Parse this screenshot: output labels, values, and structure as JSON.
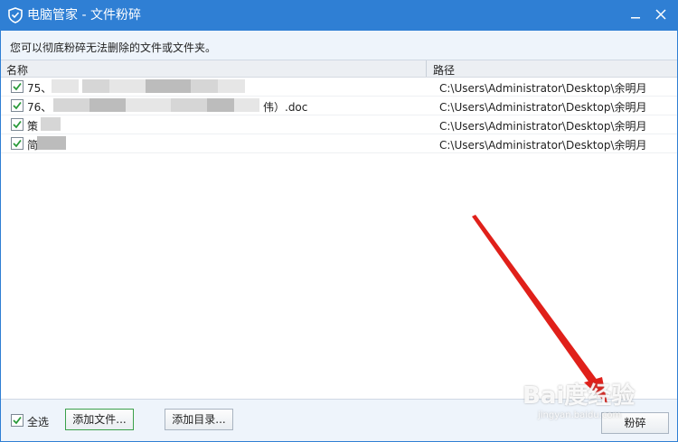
{
  "window": {
    "title": "电脑管家 - 文件粉碎"
  },
  "description": "您可以彻底粉碎无法删除的文件或文件夹。",
  "list": {
    "col_name": "名称",
    "col_path": "路径",
    "rows": [
      {
        "name": "75、",
        "path": "C:\\Users\\Administrator\\Desktop\\余明月",
        "checked": true
      },
      {
        "name": "76、",
        "name_suffix": "伟）.doc",
        "path": "C:\\Users\\Administrator\\Desktop\\余明月",
        "checked": true
      },
      {
        "name": "策",
        "path": "C:\\Users\\Administrator\\Desktop\\余明月",
        "checked": true
      },
      {
        "name": "简",
        "path": "C:\\Users\\Administrator\\Desktop\\余明月",
        "checked": true
      }
    ]
  },
  "bottom": {
    "select_all": "全选",
    "add_file": "添加文件...",
    "add_dir": "添加目录...",
    "shred": "粉碎"
  },
  "watermark": {
    "text": "Bai度经验",
    "sub": "jingyan.baidu.com"
  },
  "colors": {
    "titlebar": "#2f7fd4",
    "accent_arrow": "#e0201a",
    "check": "#2a9a3a"
  }
}
